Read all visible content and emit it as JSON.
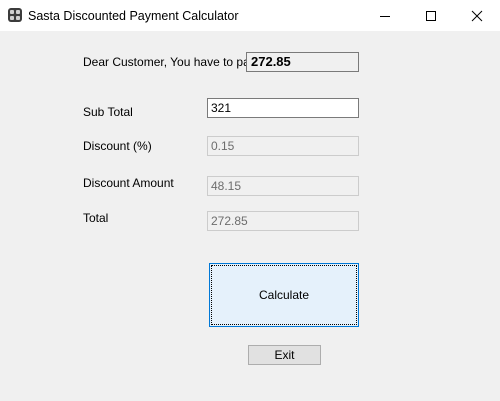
{
  "window": {
    "title": "Sasta Discounted Payment Calculator",
    "icon": "calculator-icon"
  },
  "title_buttons": {
    "minimize_icon": "minimize-icon",
    "maximize_icon": "maximize-icon",
    "close_icon": "close-icon"
  },
  "form": {
    "pay_label": "Dear Customer, You have to pay",
    "pay_value": "272.85",
    "subtotal_label": "Sub Total",
    "subtotal_value": "321",
    "discount_label": "Discount (%)",
    "discount_value": "0.15",
    "discount_amount_label": "Discount Amount",
    "discount_amount_value": "48.15",
    "total_label": "Total",
    "total_value": "272.85"
  },
  "buttons": {
    "calculate_label": "Calculate",
    "exit_label": "Exit"
  },
  "colors": {
    "window_bg": "#f0f0f0",
    "titlebar_bg": "#ffffff",
    "focus_button_bg": "#e5f1fb",
    "focus_border": "#0078d7",
    "button_bg": "#e1e1e1"
  }
}
